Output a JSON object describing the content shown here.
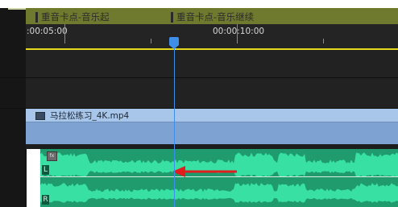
{
  "markers": [
    {
      "label": "重音卡点-音乐起"
    },
    {
      "label": "重音卡点-音乐继续"
    }
  ],
  "ruler": {
    "labels": [
      ":00:05:00",
      "00:00:10:00"
    ]
  },
  "video_clip": {
    "label": "马拉松练习_4K.mp4"
  },
  "audio_clip": {
    "fx_badge": "fx",
    "channel_left": "L",
    "channel_right": "R"
  },
  "colors": {
    "marker_bar": "#6f7a2e",
    "ruler_bg": "#242424",
    "work_area_line": "#e5d81a",
    "video_clip": "#93b5df",
    "audio_clip": "#1f9b6e",
    "waveform": "#38e0a3",
    "playhead": "#3f8fe8",
    "annotation_arrow": "#e11d1d"
  },
  "icons": [
    "marker-pin-icon",
    "film-icon",
    "fx-icon",
    "playhead-icon",
    "arrow-left-icon"
  ]
}
